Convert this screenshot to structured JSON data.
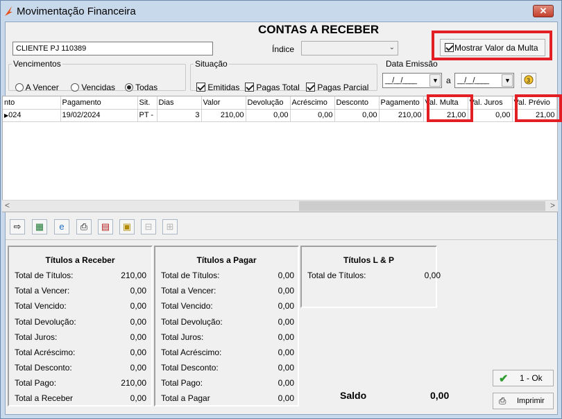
{
  "window": {
    "title": "Movimentação Financeira",
    "close_glyph": "✕"
  },
  "heading": "CONTAS A RECEBER",
  "client_field": {
    "value": "CLIENTE PJ 110389"
  },
  "indice": {
    "label": "Índice",
    "value": ""
  },
  "multa_toggle": {
    "label": "Mostrar Valor da Multa",
    "checked": true
  },
  "vencimentos": {
    "legend": "Vencimentos",
    "options": [
      {
        "label": "A Vencer",
        "selected": false
      },
      {
        "label": "Vencidas",
        "selected": false
      },
      {
        "label": "Todas",
        "selected": true
      }
    ]
  },
  "situacao": {
    "legend": "Situação",
    "options": [
      {
        "label": "Emitidas",
        "checked": true
      },
      {
        "label": "Pagas Total",
        "checked": true
      },
      {
        "label": "Pagas Parcial",
        "checked": true
      }
    ]
  },
  "data_emissao": {
    "legend": "Data Emissão",
    "from": "__/__/____",
    "to": "__/__/____",
    "sep": "a"
  },
  "grid": {
    "columns": [
      "nto",
      "Pagamento",
      "Sit.",
      "Dias",
      "Valor",
      "Devolução",
      "Acréscimo",
      "Desconto",
      "Pagamento",
      "Val. Multa",
      "Val. Juros",
      "Val. Prévio"
    ],
    "rows": [
      [
        "024",
        "19/02/2024",
        "PT -",
        "3",
        "210,00",
        "0,00",
        "0,00",
        "0,00",
        "210,00",
        "21,00",
        "0,00",
        "21,00"
      ]
    ]
  },
  "toolbar_icons": [
    "export-icon",
    "excel-icon",
    "internet-explorer-icon",
    "print-icon",
    "print-list-icon",
    "document-icon",
    "tree-collapse-icon",
    "tree-expand-icon"
  ],
  "panels": [
    {
      "title": "Títulos a Receber",
      "rows": [
        [
          "Total de Títulos:",
          "210,00"
        ],
        [
          "Total a Vencer:",
          "0,00"
        ],
        [
          "Total Vencido:",
          "0,00"
        ],
        [
          "Total Devolução:",
          "0,00"
        ],
        [
          "Total Juros:",
          "0,00"
        ],
        [
          "Total Acréscimo:",
          "0,00"
        ],
        [
          "Total Desconto:",
          "0,00"
        ],
        [
          "Total Pago:",
          "210,00"
        ],
        [
          "Total a Receber",
          "0,00"
        ]
      ]
    },
    {
      "title": "Títulos a Pagar",
      "rows": [
        [
          "Total de Títulos:",
          "0,00"
        ],
        [
          "Total a Vencer:",
          "0,00"
        ],
        [
          "Total Vencido:",
          "0,00"
        ],
        [
          "Total Devolução:",
          "0,00"
        ],
        [
          "Total Juros:",
          "0,00"
        ],
        [
          "Total Acréscimo:",
          "0,00"
        ],
        [
          "Total Desconto:",
          "0,00"
        ],
        [
          "Total Pago:",
          "0,00"
        ],
        [
          "Total a Pagar",
          "0,00"
        ]
      ]
    },
    {
      "title": "Títulos L & P",
      "rows": [
        [
          "Total de Títulos:",
          "0,00"
        ]
      ]
    }
  ],
  "saldo": {
    "label": "Saldo",
    "value": "0,00"
  },
  "buttons": {
    "ok": "1 - Ok",
    "print": "Imprimir"
  },
  "colors": {
    "highlight": "#e41e25",
    "window_frame": "#c9d9ec"
  }
}
